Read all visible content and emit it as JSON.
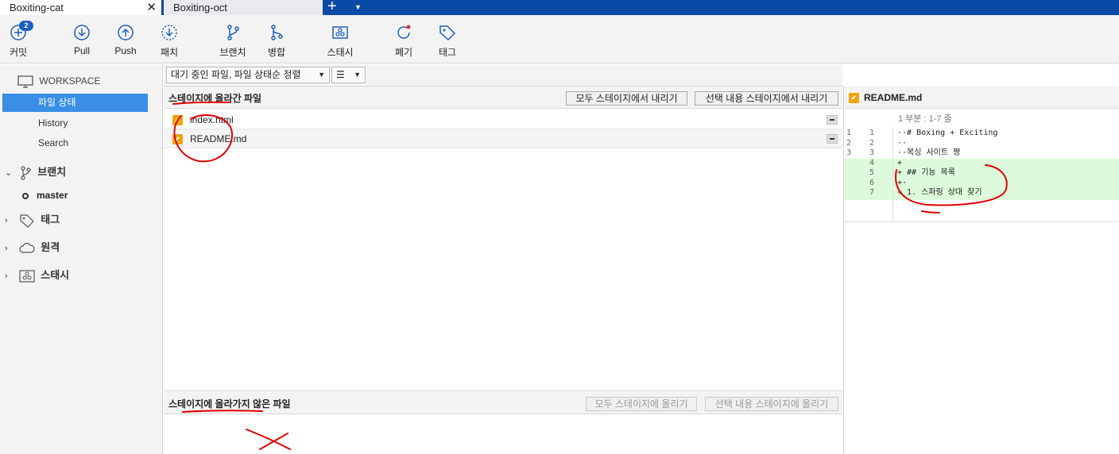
{
  "tabs": [
    {
      "label": "Boxiting-cat",
      "active": true
    },
    {
      "label": "Boxiting-oct",
      "active": false
    }
  ],
  "toolbar": {
    "commit": {
      "label": "커밋",
      "badge": "2"
    },
    "pull": "Pull",
    "push": "Push",
    "fetch": "패치",
    "branch": "브랜치",
    "merge": "병합",
    "stash": "스태시",
    "discard": "폐기",
    "tag": "태그"
  },
  "sidebar": {
    "workspace": "WORKSPACE",
    "items": [
      "파일 상태",
      "History",
      "Search"
    ],
    "branches": "브랜치",
    "master": "master",
    "tags": "태그",
    "remotes": "원격",
    "stashes": "스태시"
  },
  "filter": {
    "sort_label": "대기 중인 파일, 파일 상태순 정렬",
    "view_icon": "list-icon"
  },
  "staged": {
    "title": "스테이지에 올라간 파일",
    "unstage_all": "모두 스테이지에서 내리기",
    "unstage_selected": "선택 내용 스테이지에서 내리기",
    "files": [
      "index.html",
      "README.md"
    ]
  },
  "unstaged": {
    "title": "스테이지에 올라가지 않은 파일",
    "stage_all": "모두 스테이지에 올리기",
    "stage_selected": "선택 내용 스테이지에 올리기"
  },
  "diff": {
    "filename": "README.md",
    "hunk": "1 부분 : 1-7 줄",
    "lines": [
      {
        "old": "1",
        "new": "1",
        "code": "··# Boxing + Exciting",
        "type": "ctx"
      },
      {
        "old": "2",
        "new": "2",
        "code": "··",
        "type": "ctx"
      },
      {
        "old": "3",
        "new": "3",
        "code": "··복싱 사이트 짱",
        "type": "ctx"
      },
      {
        "old": "",
        "new": "4",
        "code": "+",
        "type": "add"
      },
      {
        "old": "",
        "new": "5",
        "code": "+ ## 기능 목록",
        "type": "add"
      },
      {
        "old": "",
        "new": "6",
        "code": "+·",
        "type": "add"
      },
      {
        "old": "",
        "new": "7",
        "code": "+ 1. 스파링 상대 찾기",
        "type": "add"
      }
    ]
  },
  "colors": {
    "tabbar": "#0a4aa6",
    "selection": "#3a8ee6",
    "modified_icon": "#f0a30a",
    "added_line": "#ddfbdc",
    "annotation": "#e00000"
  }
}
